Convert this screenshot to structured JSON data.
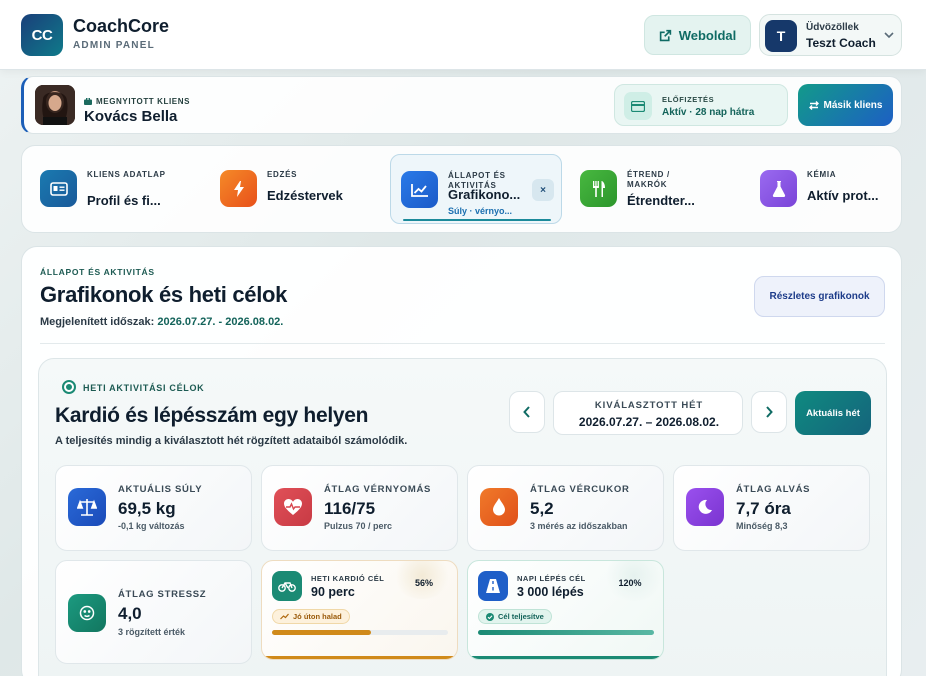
{
  "header": {
    "logo_text": "CC",
    "app_name": "CoachCore",
    "app_sub": "ADMIN PANEL",
    "web_button": "Weboldal",
    "user_avatar": "T",
    "greeting": "Üdvözöllek",
    "user_name": "Teszt Coach"
  },
  "client": {
    "label": "MEGNYITOTT KLIENS",
    "name": "Kovács Bella",
    "subscription_label": "ELŐFIZETÉS",
    "subscription_value": "Aktív · 28 nap hátra",
    "switch_button": "Másik kliens"
  },
  "tabs": [
    {
      "label": "KLIENS ADATLAP",
      "title": "Profil és fi...",
      "icon": "id-card-icon",
      "color": "#1b6fa8"
    },
    {
      "label": "EDZÉS",
      "title": "Edzéstervek",
      "icon": "bolt-icon",
      "color": "#f06a1e"
    },
    {
      "label": "ÁLLAPOT ÉS AKTIVITÁS",
      "title": "Grafikono...",
      "subtitle": "Súly · vérnyo...",
      "icon": "chart-icon",
      "color": "#1f6fd8",
      "active": true,
      "close": "×"
    },
    {
      "label": "ÉTREND / MAKRÓK",
      "title": "Étrendter...",
      "icon": "fork-knife-icon",
      "color": "#3aa83a"
    },
    {
      "label": "KÉMIA",
      "title": "Aktív prot...",
      "icon": "flask-icon",
      "color": "#8a5ae8"
    }
  ],
  "main": {
    "label": "ÁLLAPOT ÉS AKTIVITÁS",
    "title": "Grafikonok és heti célok",
    "period_label": "Megjelenített időszak:",
    "period_value": "2026.07.27. - 2026.08.02.",
    "details_button": "Részletes grafikonok"
  },
  "weekly": {
    "label": "HETI AKTIVITÁSI CÉLOK",
    "title": "Kardió és lépésszám egy helyen",
    "note": "A teljesítés mindig a kiválasztott hét rögzített adataiból számolódik.",
    "prev": "‹",
    "next": "›",
    "week_label": "KIVÁLASZTOTT HÉT",
    "week_value": "2026.07.27. – 2026.08.02.",
    "current_button": "Aktuális hét"
  },
  "metrics": [
    {
      "label": "AKTUÁLIS SÚLY",
      "value": "69,5 kg",
      "sub": "-0,1 kg változás",
      "icon": "scale-icon",
      "color": "#2a6ad8"
    },
    {
      "label": "ÁTLAG VÉRNYOMÁS",
      "value": "116/75",
      "sub": "Pulzus 70 / perc",
      "icon": "heart-pulse-icon",
      "color": "#d8474f"
    },
    {
      "label": "ÁTLAG VÉRCUKOR",
      "value": "5,2",
      "sub": "3 mérés az időszakban",
      "icon": "drop-icon",
      "color": "#ec6a22"
    },
    {
      "label": "ÁTLAG ALVÁS",
      "value": "7,7 óra",
      "sub": "Minőség 8,3",
      "icon": "moon-icon",
      "color": "#8a44e0"
    },
    {
      "label": "ÁTLAG STRESSZ",
      "value": "4,0",
      "sub": "3 rögzített érték",
      "icon": "face-icon",
      "color": "#1b8a74"
    }
  ],
  "goals": [
    {
      "label": "HETI KARDIÓ CÉL",
      "value": "90 perc",
      "percent": "56%",
      "progress": 0.56,
      "tag": "Jó úton halad",
      "icon": "bike-icon",
      "color": "#1b8a74",
      "bar": "#d08a1a",
      "tag_bg": "#fdf1dc",
      "tag_fg": "#9a5a0a"
    },
    {
      "label": "NAPI LÉPÉS CÉL",
      "value": "3 000 lépés",
      "percent": "120%",
      "progress": 1.0,
      "tag": "Cél teljesítve",
      "icon": "road-icon",
      "color": "#1f5fc8",
      "bar": "#1b8a74",
      "tag_bg": "#e2f4ee",
      "tag_fg": "#13635a"
    }
  ]
}
